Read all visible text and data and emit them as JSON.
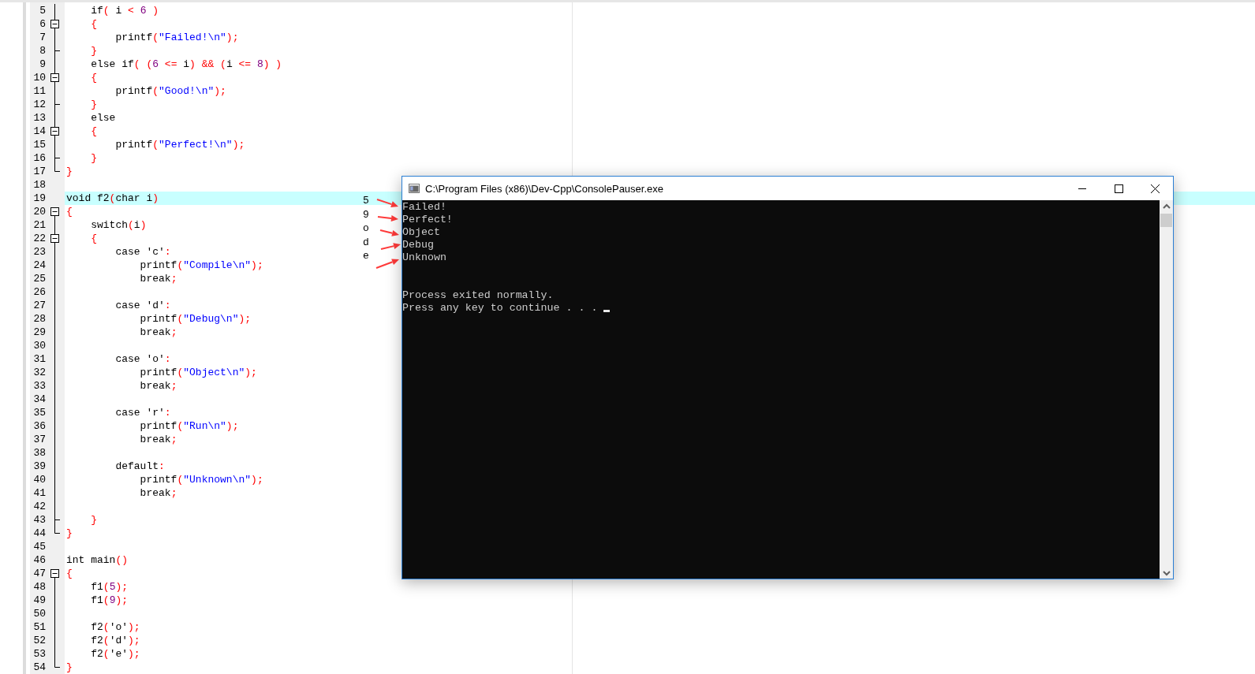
{
  "editor": {
    "lines": [
      {
        "number": "5",
        "kind": "fold-line",
        "current": false,
        "tokens": [
          {
            "kind": "code",
            "text": "    if"
          },
          {
            "kind": "sym",
            "text": "("
          },
          {
            "kind": "code",
            "text": " i "
          },
          {
            "kind": "sym",
            "text": "< "
          },
          {
            "kind": "num",
            "text": "6"
          },
          {
            "kind": "sym",
            "text": " )"
          }
        ]
      },
      {
        "number": "6",
        "kind": "fold-nested-start",
        "current": false,
        "tokens": [
          {
            "kind": "sym",
            "text": "    {"
          }
        ]
      },
      {
        "number": "7",
        "kind": "fold-line",
        "current": false,
        "tokens": [
          {
            "kind": "code",
            "text": "        printf"
          },
          {
            "kind": "sym",
            "text": "("
          },
          {
            "kind": "str",
            "text": "\"Failed!\\n\""
          },
          {
            "kind": "sym",
            "text": ");"
          }
        ]
      },
      {
        "number": "8",
        "kind": "fold-mid",
        "current": false,
        "tokens": [
          {
            "kind": "sym",
            "text": "    }"
          }
        ]
      },
      {
        "number": "9",
        "kind": "fold-line",
        "current": false,
        "tokens": [
          {
            "kind": "code",
            "text": "    else if"
          },
          {
            "kind": "sym",
            "text": "( ("
          },
          {
            "kind": "num",
            "text": "6"
          },
          {
            "kind": "sym",
            "text": " <="
          },
          {
            "kind": "code",
            "text": " i"
          },
          {
            "kind": "sym",
            "text": ") && ("
          },
          {
            "kind": "code",
            "text": "i "
          },
          {
            "kind": "sym",
            "text": "<= "
          },
          {
            "kind": "num",
            "text": "8"
          },
          {
            "kind": "sym",
            "text": ") )"
          }
        ]
      },
      {
        "number": "10",
        "kind": "fold-nested-start",
        "current": false,
        "tokens": [
          {
            "kind": "sym",
            "text": "    {"
          }
        ]
      },
      {
        "number": "11",
        "kind": "fold-line",
        "current": false,
        "tokens": [
          {
            "kind": "code",
            "text": "        printf"
          },
          {
            "kind": "sym",
            "text": "("
          },
          {
            "kind": "str",
            "text": "\"Good!\\n\""
          },
          {
            "kind": "sym",
            "text": ");"
          }
        ]
      },
      {
        "number": "12",
        "kind": "fold-mid",
        "current": false,
        "tokens": [
          {
            "kind": "sym",
            "text": "    }"
          }
        ]
      },
      {
        "number": "13",
        "kind": "fold-line",
        "current": false,
        "tokens": [
          {
            "kind": "code",
            "text": "    else"
          }
        ]
      },
      {
        "number": "14",
        "kind": "fold-nested-start",
        "current": false,
        "tokens": [
          {
            "kind": "sym",
            "text": "    {"
          }
        ]
      },
      {
        "number": "15",
        "kind": "fold-line",
        "current": false,
        "tokens": [
          {
            "kind": "code",
            "text": "        printf"
          },
          {
            "kind": "sym",
            "text": "("
          },
          {
            "kind": "str",
            "text": "\"Perfect!\\n\""
          },
          {
            "kind": "sym",
            "text": ");"
          }
        ]
      },
      {
        "number": "16",
        "kind": "fold-mid",
        "current": false,
        "tokens": [
          {
            "kind": "sym",
            "text": "    }"
          }
        ]
      },
      {
        "number": "17",
        "kind": "fold-last",
        "current": false,
        "tokens": [
          {
            "kind": "sym",
            "text": "}"
          }
        ]
      },
      {
        "number": "18",
        "kind": "plain",
        "current": false
      },
      {
        "number": "19",
        "kind": "plain",
        "current": true,
        "tokens": [
          {
            "kind": "code",
            "text": "void f2"
          },
          {
            "kind": "sym",
            "text": "("
          },
          {
            "kind": "code",
            "text": "char i"
          },
          {
            "kind": "sym",
            "text": ")"
          }
        ]
      },
      {
        "number": "20",
        "kind": "fold-start",
        "current": false,
        "tokens": [
          {
            "kind": "sym",
            "text": "{"
          }
        ]
      },
      {
        "number": "21",
        "kind": "fold-line",
        "current": false,
        "tokens": [
          {
            "kind": "code",
            "text": "    switch"
          },
          {
            "kind": "sym",
            "text": "("
          },
          {
            "kind": "code",
            "text": "i"
          },
          {
            "kind": "sym",
            "text": ")"
          }
        ]
      },
      {
        "number": "22",
        "kind": "fold-nested-start",
        "current": false,
        "tokens": [
          {
            "kind": "sym",
            "text": "    {"
          }
        ]
      },
      {
        "number": "23",
        "kind": "fold-line",
        "current": false,
        "tokens": [
          {
            "kind": "code",
            "text": "        case 'c'"
          },
          {
            "kind": "sym",
            "text": ":"
          }
        ]
      },
      {
        "number": "24",
        "kind": "fold-line",
        "current": false,
        "tokens": [
          {
            "kind": "code",
            "text": "            printf"
          },
          {
            "kind": "sym",
            "text": "("
          },
          {
            "kind": "str",
            "text": "\"Compile\\n\""
          },
          {
            "kind": "sym",
            "text": ");"
          }
        ]
      },
      {
        "number": "25",
        "kind": "fold-line",
        "current": false,
        "tokens": [
          {
            "kind": "code",
            "text": "            break"
          },
          {
            "kind": "sym",
            "text": ";"
          }
        ]
      },
      {
        "number": "26",
        "kind": "fold-line",
        "current": false
      },
      {
        "number": "27",
        "kind": "fold-line",
        "current": false,
        "tokens": [
          {
            "kind": "code",
            "text": "        case 'd'"
          },
          {
            "kind": "sym",
            "text": ":"
          }
        ]
      },
      {
        "number": "28",
        "kind": "fold-line",
        "current": false,
        "tokens": [
          {
            "kind": "code",
            "text": "            printf"
          },
          {
            "kind": "sym",
            "text": "("
          },
          {
            "kind": "str",
            "text": "\"Debug\\n\""
          },
          {
            "kind": "sym",
            "text": ");"
          }
        ]
      },
      {
        "number": "29",
        "kind": "fold-line",
        "current": false,
        "tokens": [
          {
            "kind": "code",
            "text": "            break"
          },
          {
            "kind": "sym",
            "text": ";"
          }
        ]
      },
      {
        "number": "30",
        "kind": "fold-line",
        "current": false
      },
      {
        "number": "31",
        "kind": "fold-line",
        "current": false,
        "tokens": [
          {
            "kind": "code",
            "text": "        case 'o'"
          },
          {
            "kind": "sym",
            "text": ":"
          }
        ]
      },
      {
        "number": "32",
        "kind": "fold-line",
        "current": false,
        "tokens": [
          {
            "kind": "code",
            "text": "            printf"
          },
          {
            "kind": "sym",
            "text": "("
          },
          {
            "kind": "str",
            "text": "\"Object\\n\""
          },
          {
            "kind": "sym",
            "text": ");"
          }
        ]
      },
      {
        "number": "33",
        "kind": "fold-line",
        "current": false,
        "tokens": [
          {
            "kind": "code",
            "text": "            break"
          },
          {
            "kind": "sym",
            "text": ";"
          }
        ]
      },
      {
        "number": "34",
        "kind": "fold-line",
        "current": false
      },
      {
        "number": "35",
        "kind": "fold-line",
        "current": false,
        "tokens": [
          {
            "kind": "code",
            "text": "        case 'r'"
          },
          {
            "kind": "sym",
            "text": ":"
          }
        ]
      },
      {
        "number": "36",
        "kind": "fold-line",
        "current": false,
        "tokens": [
          {
            "kind": "code",
            "text": "            printf"
          },
          {
            "kind": "sym",
            "text": "("
          },
          {
            "kind": "str",
            "text": "\"Run\\n\""
          },
          {
            "kind": "sym",
            "text": ");"
          }
        ]
      },
      {
        "number": "37",
        "kind": "fold-line",
        "current": false,
        "tokens": [
          {
            "kind": "code",
            "text": "            break"
          },
          {
            "kind": "sym",
            "text": ";"
          }
        ]
      },
      {
        "number": "38",
        "kind": "fold-line",
        "current": false
      },
      {
        "number": "39",
        "kind": "fold-line",
        "current": false,
        "tokens": [
          {
            "kind": "code",
            "text": "        default"
          },
          {
            "kind": "sym",
            "text": ":"
          }
        ]
      },
      {
        "number": "40",
        "kind": "fold-line",
        "current": false,
        "tokens": [
          {
            "kind": "code",
            "text": "            printf"
          },
          {
            "kind": "sym",
            "text": "("
          },
          {
            "kind": "str",
            "text": "\"Unknown\\n\""
          },
          {
            "kind": "sym",
            "text": ");"
          }
        ]
      },
      {
        "number": "41",
        "kind": "fold-line",
        "current": false,
        "tokens": [
          {
            "kind": "code",
            "text": "            break"
          },
          {
            "kind": "sym",
            "text": ";"
          }
        ]
      },
      {
        "number": "42",
        "kind": "fold-line",
        "current": false
      },
      {
        "number": "43",
        "kind": "fold-mid",
        "current": false,
        "tokens": [
          {
            "kind": "sym",
            "text": "    }"
          }
        ]
      },
      {
        "number": "44",
        "kind": "fold-last",
        "current": false,
        "tokens": [
          {
            "kind": "sym",
            "text": "}"
          }
        ]
      },
      {
        "number": "45",
        "kind": "plain",
        "current": false
      },
      {
        "number": "46",
        "kind": "plain",
        "current": false,
        "tokens": [
          {
            "kind": "code",
            "text": "int main"
          },
          {
            "kind": "sym",
            "text": "()"
          }
        ]
      },
      {
        "number": "47",
        "kind": "fold-start",
        "current": false,
        "tokens": [
          {
            "kind": "sym",
            "text": "{"
          }
        ]
      },
      {
        "number": "48",
        "kind": "fold-line",
        "current": false,
        "tokens": [
          {
            "kind": "code",
            "text": "    f1"
          },
          {
            "kind": "sym",
            "text": "("
          },
          {
            "kind": "num",
            "text": "5"
          },
          {
            "kind": "sym",
            "text": ");"
          }
        ]
      },
      {
        "number": "49",
        "kind": "fold-line",
        "current": false,
        "tokens": [
          {
            "kind": "code",
            "text": "    f1"
          },
          {
            "kind": "sym",
            "text": "("
          },
          {
            "kind": "num",
            "text": "9"
          },
          {
            "kind": "sym",
            "text": ");"
          }
        ]
      },
      {
        "number": "50",
        "kind": "fold-line",
        "current": false
      },
      {
        "number": "51",
        "kind": "fold-line",
        "current": false,
        "tokens": [
          {
            "kind": "code",
            "text": "    f2"
          },
          {
            "kind": "sym",
            "text": "("
          },
          {
            "kind": "code",
            "text": "'o'"
          },
          {
            "kind": "sym",
            "text": ");"
          }
        ]
      },
      {
        "number": "52",
        "kind": "fold-line",
        "current": false,
        "tokens": [
          {
            "kind": "code",
            "text": "    f2"
          },
          {
            "kind": "sym",
            "text": "("
          },
          {
            "kind": "code",
            "text": "'d'"
          },
          {
            "kind": "sym",
            "text": ");"
          }
        ]
      },
      {
        "number": "53",
        "kind": "fold-line",
        "current": false,
        "tokens": [
          {
            "kind": "code",
            "text": "    f2"
          },
          {
            "kind": "sym",
            "text": "("
          },
          {
            "kind": "code",
            "text": "'e'"
          },
          {
            "kind": "sym",
            "text": ");"
          }
        ]
      },
      {
        "number": "54",
        "kind": "fold-last",
        "current": false,
        "tokens": [
          {
            "kind": "sym",
            "text": "}"
          }
        ]
      }
    ]
  },
  "annotations": {
    "inputs": [
      "5",
      "9",
      "o",
      "d",
      "e"
    ]
  },
  "console": {
    "title": "C:\\Program Files (x86)\\Dev-Cpp\\ConsolePauser.exe",
    "output": [
      "Failed!",
      "Perfect!",
      "Object",
      "Debug",
      "Unknown"
    ],
    "footer": [
      "Process exited normally.",
      "Press any key to continue . . ."
    ]
  }
}
